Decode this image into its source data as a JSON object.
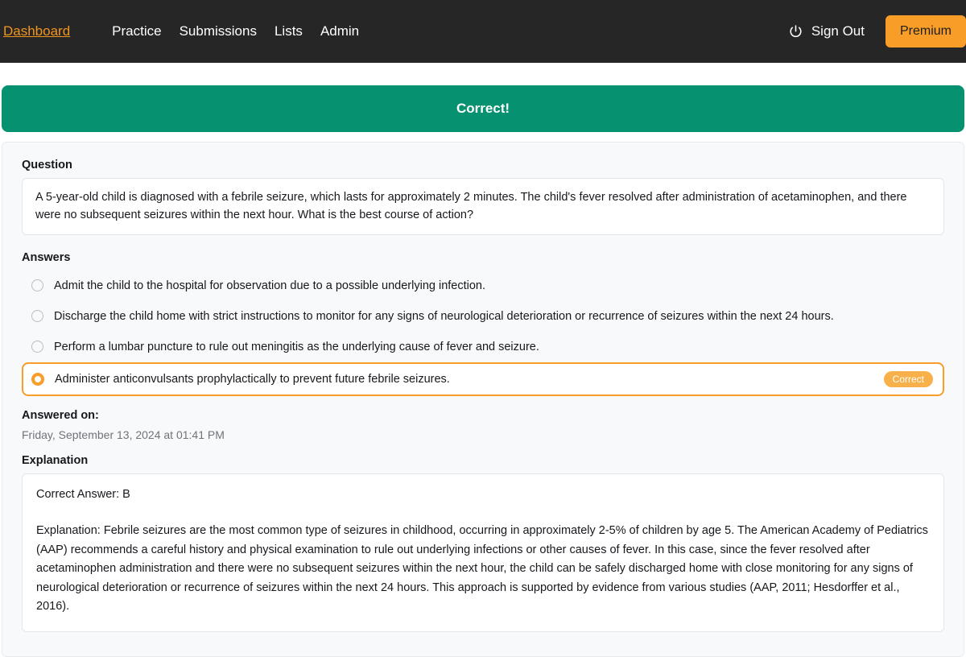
{
  "navbar": {
    "brand": "Dashboard",
    "links": [
      {
        "label": "Practice"
      },
      {
        "label": "Submissions"
      },
      {
        "label": "Lists"
      },
      {
        "label": "Admin"
      }
    ],
    "sign_out_label": "Sign Out",
    "sign_out_icon": "power-icon",
    "premium_label": "Premium",
    "colors": {
      "background": "#262626",
      "brand_text": "#f0951e",
      "premium_background": "#f79d28"
    }
  },
  "banner": {
    "text": "Correct!",
    "color": "#069171"
  },
  "question": {
    "label": "Question",
    "text": "A 5-year-old child is diagnosed with a febrile seizure, which lasts for approximately 2 minutes. The child's fever resolved after administration of acetaminophen, and there were no subsequent seizures within the next hour. What is the best course of action?"
  },
  "answers": {
    "label": "Answers",
    "options": [
      {
        "text": "Admit the child to the hospital for observation due to a possible underlying infection.",
        "selected": false,
        "badge": ""
      },
      {
        "text": "Discharge the child home with strict instructions to monitor for any signs of neurological deterioration or recurrence of seizures within the next 24 hours.",
        "selected": false,
        "badge": ""
      },
      {
        "text": "Perform a lumbar puncture to rule out meningitis as the underlying cause of fever and seizure.",
        "selected": false,
        "badge": ""
      },
      {
        "text": "Administer anticonvulsants prophylactically to prevent future febrile seizures.",
        "selected": true,
        "badge": "Correct"
      }
    ],
    "selected_color": "#f79d28",
    "badge_color": "#f7b04a"
  },
  "answered_on": {
    "label": "Answered on:",
    "value": "Friday, September 13, 2024 at 01:41 PM"
  },
  "explanation": {
    "label": "Explanation",
    "correct_answer_line": "Correct Answer: B",
    "body": "Explanation: Febrile seizures are the most common type of seizures in childhood, occurring in approximately 2-5% of children by age 5. The American Academy of Pediatrics (AAP) recommends a careful history and physical examination to rule out underlying infections or other causes of fever. In this case, since the fever resolved after acetaminophen administration and there were no subsequent seizures within the next hour, the child can be safely discharged home with close monitoring for any signs of neurological deterioration or recurrence of seizures within the next 24 hours. This approach is supported by evidence from various studies (AAP, 2011; Hesdorffer et al., 2016)."
  }
}
